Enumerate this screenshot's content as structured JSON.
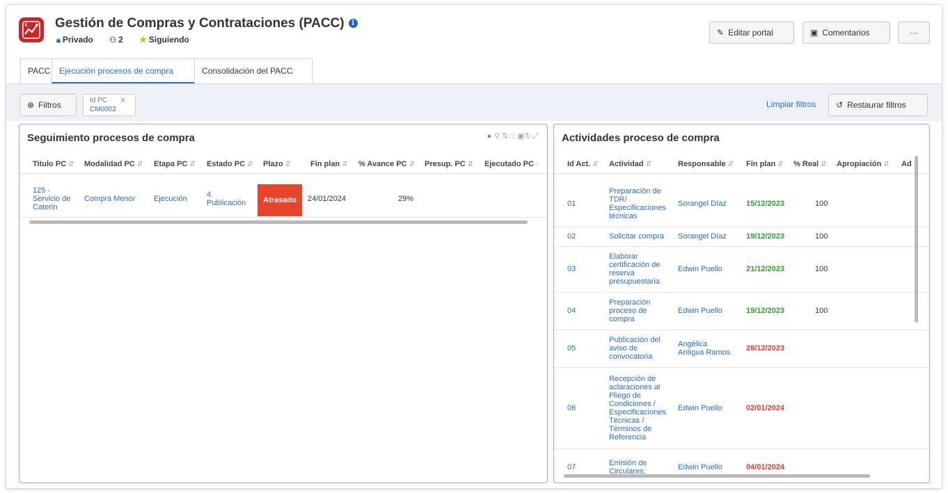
{
  "header": {
    "title": "Gestión de Compras y Contrataciones (PACC)",
    "visibility": "Privado",
    "members": "2",
    "following": "Siguiendo",
    "edit_label": "Editar portal",
    "comments_label": "Comentarios",
    "more_label": "···"
  },
  "tabs": [
    {
      "label": "PACC"
    },
    {
      "label": "Ejecución procesos de compra"
    },
    {
      "label": "Consolidación del PACC"
    }
  ],
  "filters": {
    "filter_label": "Filtros",
    "chip_label": "Id PC",
    "chip_value": "CM0002",
    "clear_label": "Limpiar filtros",
    "restore_label": "Restaurar filtros"
  },
  "left_panel": {
    "title": "Seguimiento procesos de compra",
    "columns": [
      "Titulo PC",
      "Modalidad PC",
      "Etapa PC",
      "Estado PC",
      "Plazo",
      "Fin plan",
      "% Avance PC",
      "Presup. PC",
      "Ejecutado PC"
    ],
    "row": {
      "titulo_l1": "125 -",
      "titulo_l2": "Servicio de",
      "titulo_l3": "Caterin",
      "modalidad": "Compra Menor",
      "etapa": "Ejecución",
      "estado_l1": "4.",
      "estado_l2": "Publicación",
      "plazo": "Atrasado",
      "fin_plan": "24/01/2024",
      "avance": "29%"
    }
  },
  "right_panel": {
    "title": "Actividades proceso de compra",
    "columns": [
      "Id Act.",
      "Actividad",
      "Responsable",
      "Fin plan",
      "% Real",
      "Apropiación",
      "Ad"
    ],
    "rows": [
      {
        "id": "01",
        "actividad": [
          "Preparación de",
          "TDR/",
          "Especificaciones",
          "técnicas"
        ],
        "responsable": [
          "Sorangel Díaz"
        ],
        "fin": "15/12/2023",
        "status": "green",
        "real": "100"
      },
      {
        "id": "02",
        "actividad": [
          "Solicitar compra"
        ],
        "responsable": [
          "Sorangel Díaz"
        ],
        "fin": "19/12/2023",
        "status": "green",
        "real": "100"
      },
      {
        "id": "03",
        "actividad": [
          "Elaborar",
          "certificación de",
          "reserva",
          "presupuestaria"
        ],
        "responsable": [
          "Edwin Puello"
        ],
        "fin": "21/12/2023",
        "status": "green",
        "real": "100"
      },
      {
        "id": "04",
        "actividad": [
          "Preparación",
          "proceso de",
          "compra"
        ],
        "responsable": [
          "Edwin Puello"
        ],
        "fin": "19/12/2023",
        "status": "green",
        "real": "100"
      },
      {
        "id": "05",
        "actividad": [
          "Publicación del",
          "aviso de",
          "convocatoria"
        ],
        "responsable": [
          "Angélica",
          "Antigua Ramos"
        ],
        "fin": "28/12/2023",
        "status": "red",
        "real": ""
      },
      {
        "id": "06",
        "actividad": [
          "Recepción de",
          "aclaraciones al",
          "Pliego de",
          "Condiciones /",
          "Especificaciones",
          "Técnicas /",
          "Términos de",
          "Referencia"
        ],
        "responsable": [
          "Edwin Puello"
        ],
        "fin": "02/01/2024",
        "status": "red",
        "real": ""
      },
      {
        "id": "07",
        "actividad": [
          "Emisión de",
          "Circulares,"
        ],
        "responsable": [
          "Edwin Puello"
        ],
        "fin": "04/01/2024",
        "status": "red",
        "real": ""
      }
    ]
  },
  "colors": {
    "brand": "#c9252c",
    "accent": "#2a69c4",
    "late": "#e8432d",
    "ok": "#2c9f2c"
  }
}
